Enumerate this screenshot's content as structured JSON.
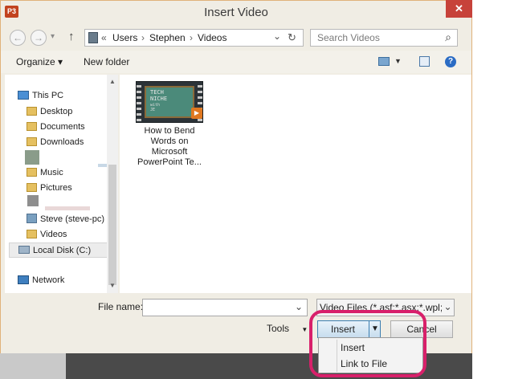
{
  "window": {
    "title": "Insert Video",
    "app_icon_text": "P3",
    "close_glyph": "✕"
  },
  "nav": {
    "back_glyph": "←",
    "forward_glyph": "→",
    "recent_glyph": "▾",
    "up_glyph": "↑",
    "breadcrumb": [
      "«",
      "Users",
      "Stephen",
      "Videos"
    ],
    "separator": "›",
    "dropdown_glyph": "⌄",
    "refresh_glyph": "↻",
    "search_placeholder": "Search Videos",
    "search_glyph": "⌕"
  },
  "toolbar": {
    "organize_label": "Organize ▾",
    "new_folder_label": "New folder",
    "help_glyph": "?"
  },
  "sidebar": {
    "this_pc": "This PC",
    "items": [
      "Desktop",
      "Documents",
      "Downloads",
      "Music",
      "Pictures"
    ],
    "steve": "Steve (steve-pc)",
    "videos": "Videos",
    "local_disk": "Local Disk (C:)",
    "network": "Network"
  },
  "files": [
    {
      "thumb_text": [
        "TECH",
        "NICHE"
      ],
      "thumb_small": "with\nJE",
      "name_lines": [
        "How to Bend",
        "Words on",
        "Microsoft",
        "PowerPoint  Te..."
      ]
    }
  ],
  "bottom": {
    "file_name_label": "File name:",
    "file_name_value": "",
    "filter_value": "Video Files (*.asf;*.asx;*.wpl;*.w",
    "tools_label": "Tools",
    "insert_label": "Insert",
    "cancel_label": "Cancel"
  },
  "insert_menu": [
    "Insert",
    "Link to File"
  ],
  "colors": {
    "accent_ring": "#d8206a",
    "close": "#c7423a",
    "folder": "#e5c060",
    "selection": "#cde8ff"
  }
}
